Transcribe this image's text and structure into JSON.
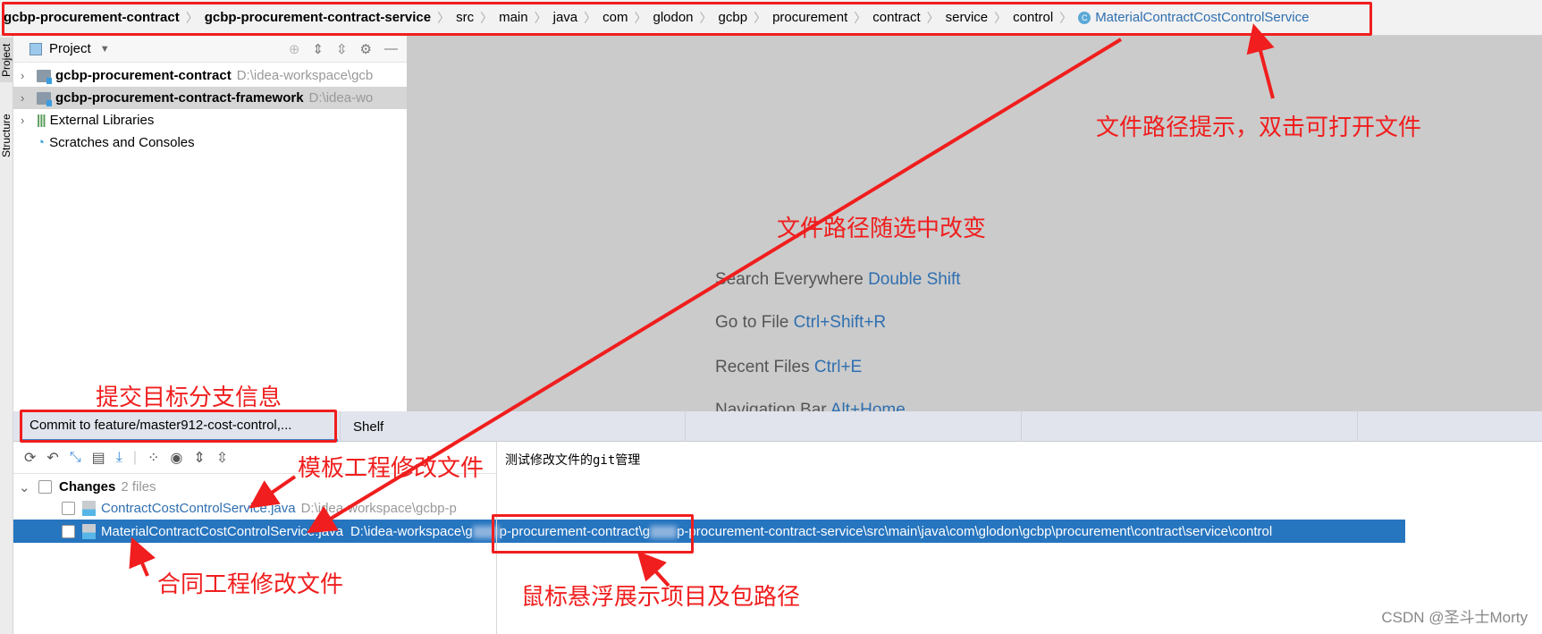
{
  "breadcrumb": {
    "items": [
      "gcbp-procurement-contract",
      "gcbp-procurement-contract-service",
      "src",
      "main",
      "java",
      "com",
      "glodon",
      "gcbp",
      "procurement",
      "contract",
      "service",
      "control"
    ],
    "current": "MaterialContractCostControlService",
    "class_icon": "C"
  },
  "side_stripe": {
    "project": "Project",
    "structure": "Structure"
  },
  "project_panel": {
    "title": "Project",
    "tree": [
      {
        "label": "gcbp-procurement-contract",
        "path": "D:\\idea-workspace\\gcb"
      },
      {
        "label": "gcbp-procurement-contract-framework",
        "path": "D:\\idea-wo"
      },
      {
        "label": "External Libraries"
      },
      {
        "label": "Scratches and Consoles"
      }
    ]
  },
  "editor_hints": [
    {
      "text": "Search Everywhere",
      "key": "Double Shift"
    },
    {
      "text": "Go to File",
      "key": "Ctrl+Shift+R"
    },
    {
      "text": "Recent Files",
      "key": "Ctrl+E"
    },
    {
      "text": "Navigation Bar",
      "key": "Alt+Home"
    }
  ],
  "bottom_tabs": {
    "commit": "Commit to feature/master912-cost-control,...",
    "shelf": "Shelf"
  },
  "changes": {
    "group": "Changes",
    "count": "2 files",
    "files": [
      {
        "name": "ContractCostControlService.java",
        "path": "D:\\idea-workspace\\gcbp-p"
      },
      {
        "name": "MaterialContractCostControlService.java",
        "path_parts": [
          "D:\\idea-workspace\\g",
          "p-procurement-contract\\g",
          "p-procurement-contract-service\\src\\main\\java\\com\\glodon\\gcbp\\procurement\\contract\\service\\control"
        ]
      }
    ]
  },
  "commit_message": "测试修改文件的git管理",
  "annotations": {
    "path_hint": "文件路径提示，双击可打开文件",
    "path_changes": "文件路径随选中改变",
    "branch_info": "提交目标分支信息",
    "template_file": "模板工程修改文件",
    "contract_file": "合同工程修改文件",
    "hover_path": "鼠标悬浮展示项目及包路径"
  },
  "watermark": "CSDN @圣斗士Morty",
  "colors": {
    "annotation": "#f01e1e",
    "selection": "#2675bf",
    "link": "#2f6fb0"
  }
}
